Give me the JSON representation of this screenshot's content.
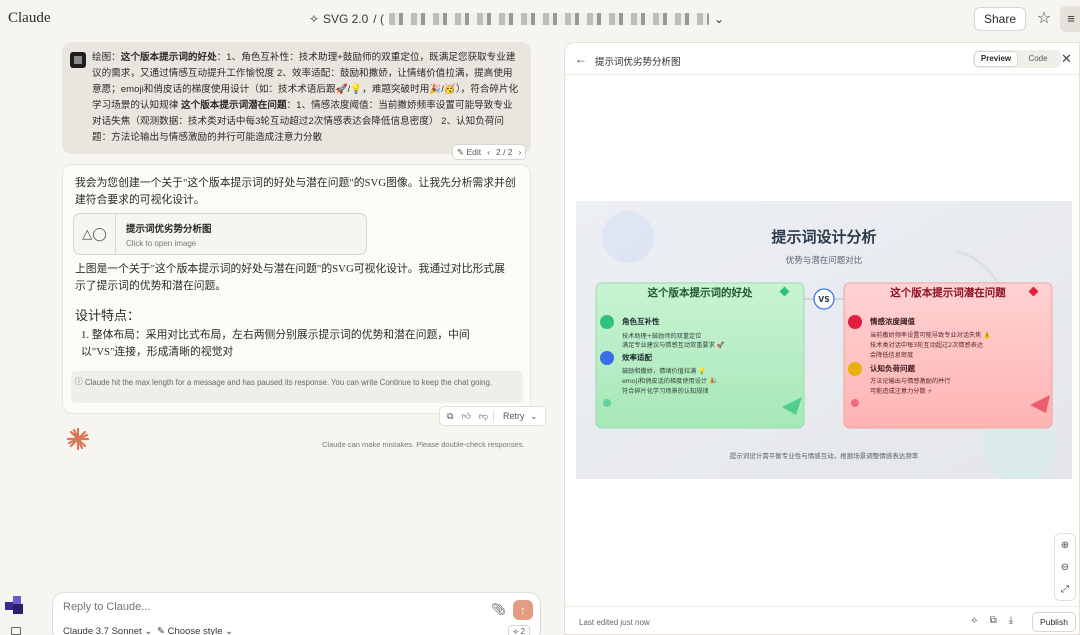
{
  "app": {
    "brand": "Claude",
    "model_chip": "SVG 2.0",
    "share_label": "Share"
  },
  "user_message": {
    "p1_prefix": "绘图：",
    "p1_bold": "这个版本提示词的好处",
    "p1_text": "：1、角色互补性：技术助理+鼓励师的双重定位，既满足您获取专业建议的需求，又通过情感互动提升工作愉悦度 2、效率适配：鼓励和撒娇，让情绪价值拉满，提高使用意愿；emoji和俏皮话的梯度使用设计（如：技术术语后跟🚀/💡，难题突破时用🎉/🥳），符合碎片化学习场景的认知规律 ",
    "p2_bold": "这个版本提示词潜在问题",
    "p2_text": "：1、情感浓度阈值：当前撒娇频率设置可能导致专业对话失焦（观测数据：技术类对话中每3轮互动超过2次情感表达会降低信息密度） 2、认知负荷问题：方法论输出与情感激励的并行可能造成注意力分散",
    "edit_label": "Edit",
    "version": "2 / 2"
  },
  "assistant_message": {
    "intro": "我会为您创建一个关于\"这个版本提示词的好处与潜在问题\"的SVG图像。让我先分析需求并创建符合要求的可视化设计。",
    "artifact_title": "提示词优劣势分析图",
    "artifact_sub": "Click to open image",
    "para2": "上图是一个关于\"这个版本提示词的好处与潜在问题\"的SVG可视化设计。我通过对比形式展示了提示词的优势和潜在问题。",
    "heading": "设计特点：",
    "li1": "1. 整体布局：采用对比式布局，左右两侧分别展示提示词的优势和潜在问题，中间以\"VS\"连接，形成清晰的视觉对",
    "notice": "Claude hit the max length for a message and has paused its response. You can write Continue to keep the chat going.",
    "retry_label": "Retry"
  },
  "disclaimer": "Claude can make mistakes. Please double-check responses.",
  "composer": {
    "placeholder": "Reply to Claude...",
    "model": "Claude 3.7 Sonnet",
    "style": "Choose style",
    "count": "2"
  },
  "panel": {
    "title": "提示词优劣势分析图",
    "tab_preview": "Preview",
    "tab_code": "Code",
    "last_edited": "Last edited just now",
    "publish_label": "Publish"
  },
  "svg_content": {
    "title": "提示词设计分析",
    "subtitle": "优势与潜在问题对比",
    "vs": "VS",
    "left_title": "这个版本提示词的好处",
    "left_items": [
      {
        "heading": "角色互补性",
        "line1": "技术助理+鼓励师的双重定位",
        "line2": "满足专业建议与情感互动双重要求 🚀"
      },
      {
        "heading": "效率适配",
        "line1": "鼓励和撒娇，情绪价值拉满 💡",
        "line2": "emoji和俏皮话的梯度使用设计 🎉",
        "line3": "符合碎片化学习场景的认知规律"
      }
    ],
    "right_title": "这个版本提示词潜在问题",
    "right_items": [
      {
        "heading": "情感浓度阈值",
        "line1": "当前撒娇频率设置可能导致专业对话失焦 ⚠️",
        "line2": "技术类对话中每3轮互动超过2次情感表达",
        "line3": "会降低信息密度"
      },
      {
        "heading": "认知负荷问题",
        "line1": "方法论输出与情感激励的并行",
        "line2": "可能造成注意力分散 ⚡"
      }
    ],
    "footer": "提示词设计需平衡专业性与情感互动，根据场景调整情感表达频率",
    "colors": {
      "green": "#2ec27e",
      "blue": "#3a6ee8",
      "red": "#e0203c",
      "amber": "#e8b010",
      "accent_orange": "#d97757"
    }
  }
}
